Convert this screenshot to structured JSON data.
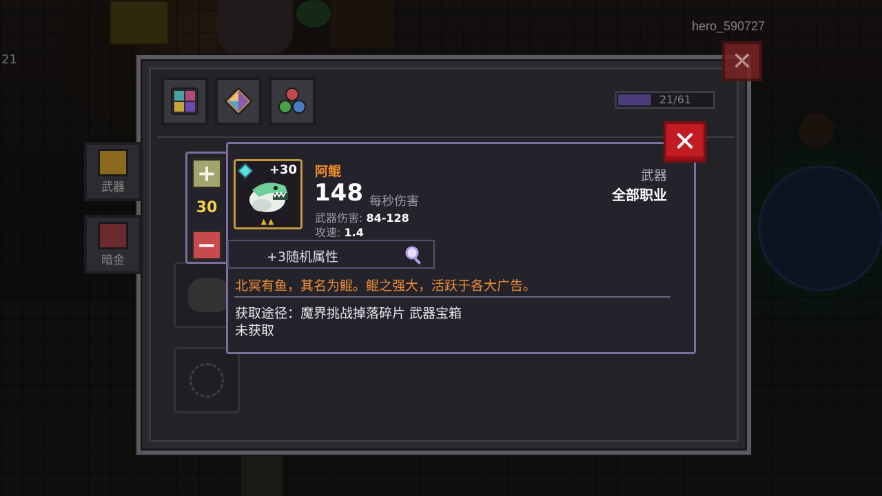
{
  "player": {
    "name": "hero_590727"
  },
  "scene": {
    "edge_number": "21"
  },
  "inventory": {
    "counter": {
      "text": "21/61",
      "current": 21,
      "max": 61
    },
    "side_tabs": [
      {
        "label": "武器"
      },
      {
        "label": "暗金"
      }
    ]
  },
  "quantity": {
    "value": "30",
    "plus": "+",
    "minus": "−"
  },
  "item": {
    "level_badge": "+30",
    "name": "阿鲲",
    "dps": "148",
    "dps_label": "每秒伤害",
    "damage_label": "武器伤害: ",
    "damage_value": "84-128",
    "speed_label": "攻速: ",
    "speed_value": "1.4",
    "type": "武器",
    "class": "全部职业",
    "random_attr": "+3随机属性",
    "description": "北冥有鱼，其名为鲲。鲲之强大，活跃于各大广告。",
    "source": "获取途径：魔界挑战掉落碎片 武器宝箱",
    "status": "未获取"
  },
  "colors": {
    "item_name": "#ea8a2b",
    "description": "#ee8f34",
    "tooltip_border": "#7a6f9e",
    "close_red": "#c21b22",
    "quantity_yellow": "#f2d34a"
  },
  "icons": {
    "close": "close-icon",
    "plus": "plus-icon",
    "minus": "minus-icon",
    "magnifier": "magnifier-icon",
    "gem": "gem-icon"
  }
}
